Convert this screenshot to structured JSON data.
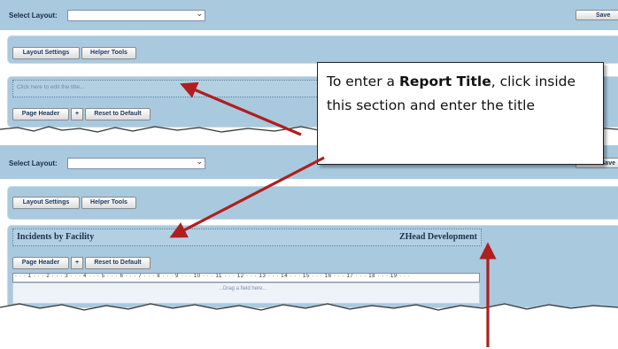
{
  "top": {
    "select_layout_label": "Select Layout:",
    "save_label": "Save",
    "layout_settings": "Layout Settings",
    "helper_tools": "Helper Tools",
    "title_placeholder": "Click here to edit the title...",
    "page_header": "Page Header",
    "plus": "+",
    "reset": "Reset to Default"
  },
  "bottom": {
    "select_layout_label": "Select Layout:",
    "save_label": "Save",
    "layout_settings": "Layout Settings",
    "helper_tools": "Helper Tools",
    "report_title": "Incidents by Facility",
    "company": "ZHead Development",
    "page_header": "Page Header",
    "plus": "+",
    "reset": "Reset to Default",
    "ruler_marks": "· · · 1 · · · 2 · · · 3 · · · 4 · · · 5 · · · 6 · · · 7 · · · 8 · · · 9 · · · 10 · · · 11 · · · 12 · · · 13 · · · 14 · · · 15 · · · 16 · · · 17 · · · 18 · · · 19 · · ·",
    "drag_hint": "...Drag a field here..."
  },
  "callout": {
    "text_before": "To enter a ",
    "text_bold": "Report Title",
    "text_after": ", click inside this section and enter the title"
  },
  "colors": {
    "panel": "#a9c9de",
    "arrow": "#b01e1e"
  }
}
